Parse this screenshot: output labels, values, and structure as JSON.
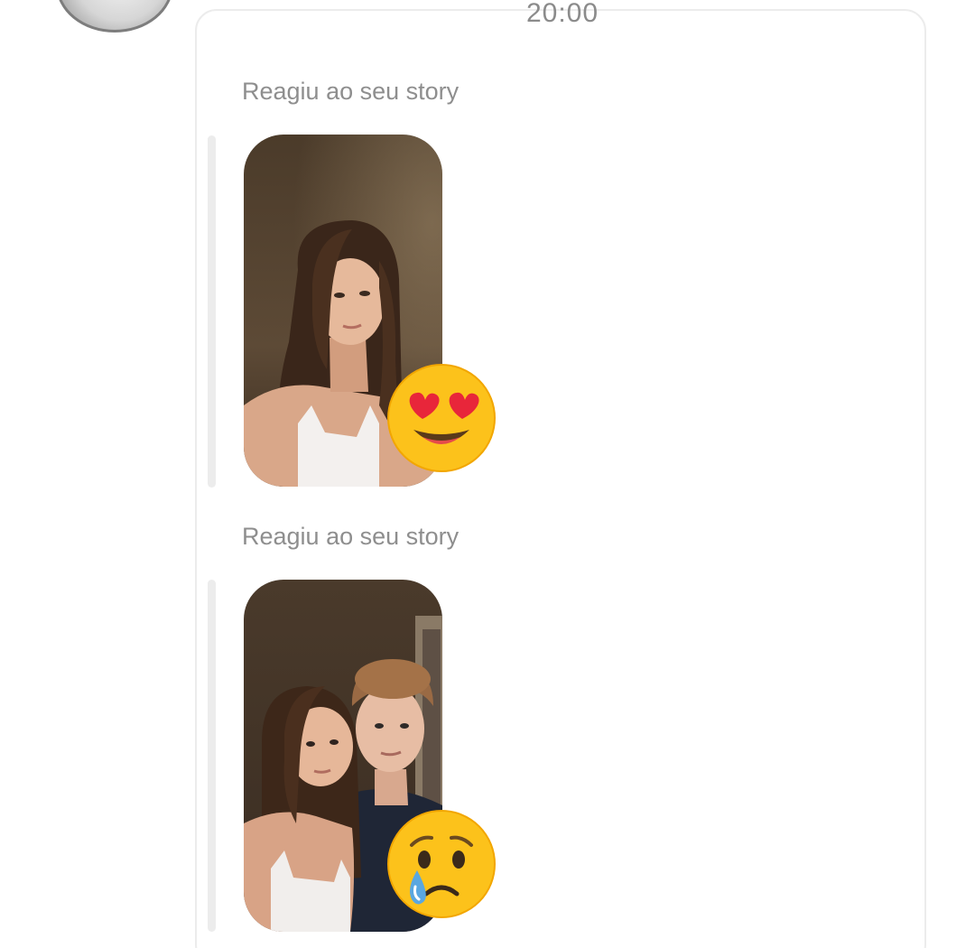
{
  "header": {
    "timestamp": "20:00"
  },
  "messages": [
    {
      "label": "Reagiu ao seu story",
      "reaction_emoji": "😍",
      "reaction_icon": "heart-eyes-emoji-icon",
      "story": "girl-selfie-story"
    },
    {
      "label": "Reagiu ao seu story",
      "reaction_emoji": "😢",
      "reaction_icon": "crying-face-emoji-icon",
      "story": "couple-selfie-story"
    }
  ],
  "colors": {
    "label_text": "#8e8e8e",
    "card_border": "#ececec",
    "emoji_yellow": "#fcc21b",
    "heart_red": "#e8263a",
    "tear_blue": "#5aa7e0"
  }
}
